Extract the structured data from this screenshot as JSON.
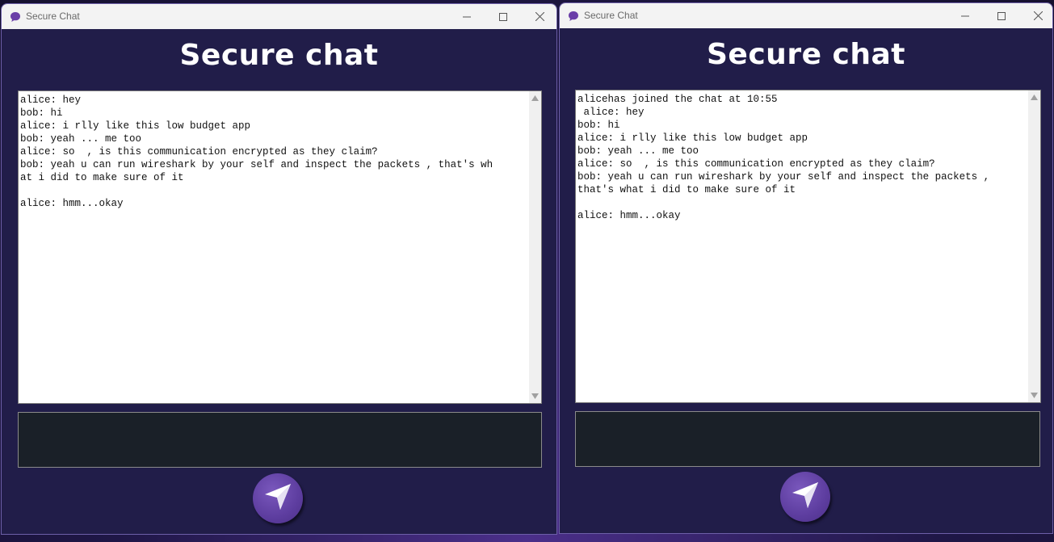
{
  "windows": [
    {
      "title": "Secure Chat",
      "heading": "Secure chat",
      "input_value": "",
      "lines": [
        "alice: hey",
        "bob: hi",
        "alice: i rlly like this low budget app",
        "bob: yeah ... me too",
        "alice: so  , is this communication encrypted as they claim?",
        "bob: yeah u can run wireshark by your self and inspect the packets , that's wh",
        "at i did to make sure of it",
        "",
        "alice: hmm...okay"
      ]
    },
    {
      "title": "Secure Chat",
      "heading": "Secure chat",
      "input_value": "",
      "lines": [
        "alicehas joined the chat at 10:55",
        " alice: hey",
        "bob: hi",
        "alice: i rlly like this low budget app",
        "bob: yeah ... me too",
        "alice: so  , is this communication encrypted as they claim?",
        "bob: yeah u can run wireshark by your self and inspect the packets ,",
        "that's what i did to make sure of it",
        "",
        "alice: hmm...okay"
      ]
    }
  ],
  "icons": {
    "app": "chat-bubble-icon",
    "minimize": "minimize-icon",
    "maximize": "maximize-icon",
    "close": "close-icon",
    "send": "send-arrow-icon",
    "scroll_up": "scroll-up-arrow-icon",
    "scroll_down": "scroll-down-arrow-icon"
  },
  "colors": {
    "window_bg": "#211d49",
    "accent": "#5d3d9f",
    "input_bg": "#1a2028"
  }
}
